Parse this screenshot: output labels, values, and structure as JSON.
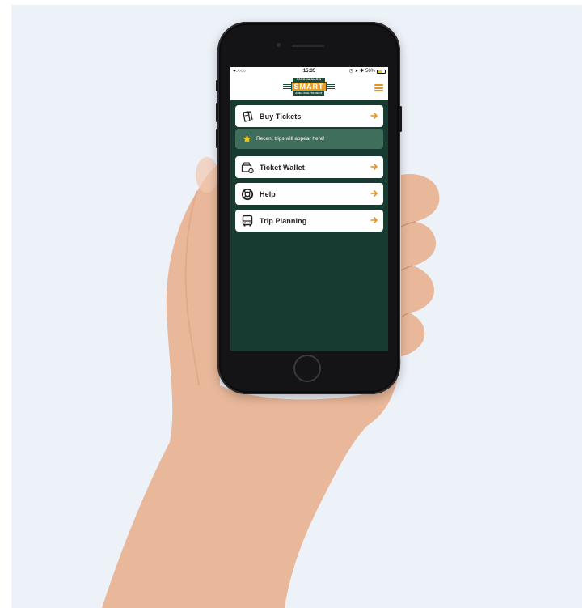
{
  "status_bar": {
    "signal": "●○○○○",
    "time": "15:35",
    "battery_text": "56%",
    "battery_level": 0.56
  },
  "logo": {
    "top_text": "SONOMA-MARIN",
    "main_text": "SMART",
    "bottom_text": "AREA RAIL TRANSIT"
  },
  "menu": {
    "buy_tickets": "Buy Tickets",
    "recent_trips": "Recent trips will appear here!",
    "ticket_wallet": "Ticket Wallet",
    "help": "Help",
    "trip_planning": "Trip Planning"
  },
  "icons": {
    "tickets": "ticket-icon",
    "star": "star-icon",
    "wallet": "wallet-icon",
    "help": "lifebuoy-icon",
    "trip": "bus-icon",
    "arrow": "arrow-right-icon",
    "menu": "hamburger-icon"
  },
  "colors": {
    "app_background": "#173b30",
    "accent": "#e69227",
    "recent_banner": "#3f6e5c",
    "star": "#f2c21b"
  }
}
